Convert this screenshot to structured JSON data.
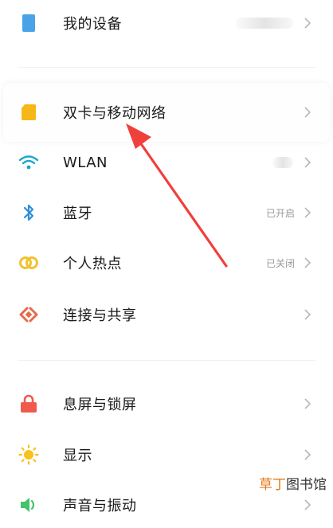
{
  "settings": {
    "items": [
      {
        "label": "我的设备",
        "status": "",
        "icon": "device-icon"
      },
      {
        "label": "双卡与移动网络",
        "status": "",
        "icon": "sim-card-icon"
      },
      {
        "label": "WLAN",
        "status": "",
        "icon": "wifi-icon"
      },
      {
        "label": "蓝牙",
        "status": "已开启",
        "icon": "bluetooth-icon"
      },
      {
        "label": "个人热点",
        "status": "已关闭",
        "icon": "hotspot-icon"
      },
      {
        "label": "连接与共享",
        "status": "",
        "icon": "connection-share-icon"
      },
      {
        "label": "息屏与锁屏",
        "status": "",
        "icon": "lock-icon"
      },
      {
        "label": "显示",
        "status": "",
        "icon": "sun-icon"
      },
      {
        "label": "声音与振动",
        "status": "",
        "icon": "speaker-icon"
      }
    ]
  },
  "watermark": {
    "part1": "草丁",
    "part2": "图书馆"
  },
  "colors": {
    "accent_red": "#f0403c",
    "device_blue": "#4aa3e6",
    "sim_yellow": "#f6b818",
    "wifi_teal": "#1aa6c9",
    "bluetooth_blue": "#2f8fd8",
    "hotspot_yellow": "#f2c230",
    "share_orange": "#e8694a",
    "lock_red": "#f05a4e",
    "sun_yellow": "#f7c21b",
    "speaker_green": "#43c36b"
  }
}
